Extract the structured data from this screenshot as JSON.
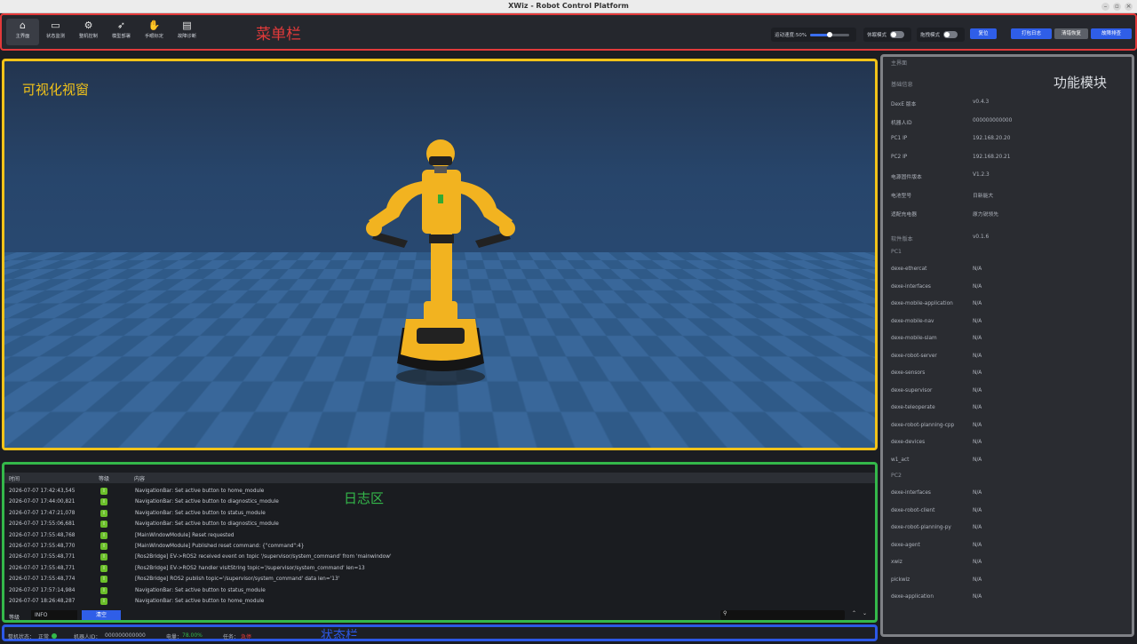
{
  "window": {
    "title": "XWiz - Robot Control Platform"
  },
  "menubar": {
    "annotation": "菜单栏",
    "nav": [
      {
        "label": "主界面",
        "icon": "home-icon",
        "glyph": "⌂"
      },
      {
        "label": "状态监测",
        "icon": "monitor-icon",
        "glyph": "▭"
      },
      {
        "label": "整机控制",
        "icon": "joystick-icon",
        "glyph": "⚙"
      },
      {
        "label": "模型部署",
        "icon": "rocket-icon",
        "glyph": "➶"
      },
      {
        "label": "手眼标定",
        "icon": "hand-icon",
        "glyph": "✋"
      },
      {
        "label": "故障诊断",
        "icon": "diagnostic-icon",
        "glyph": "▤"
      }
    ],
    "speed_label": "运动速度:50%",
    "speed_value": 0.5,
    "sleep_mode_label": "休眠模式",
    "drag_mode_label": "拖拽模式",
    "reset_label": "复位",
    "pack_log_label": "打包日志",
    "clear_error_label": "清错恢复",
    "fault_check_label": "故障排查"
  },
  "viewport": {
    "annotation": "可视化视窗"
  },
  "right_panel": {
    "header": "主界面",
    "annotation": "功能模块",
    "basic_info_title": "基础信息",
    "basic_info": [
      {
        "k": "DexE 版本",
        "v": "v0.4.3"
      },
      {
        "k": "机器人ID",
        "v": "000000000000"
      },
      {
        "k": "PC1 IP",
        "v": "192.168.20.20"
      },
      {
        "k": "PC2 IP",
        "v": "192.168.20.21"
      },
      {
        "k": "电源固件版本",
        "v": "V1.2.3"
      },
      {
        "k": "电池型号",
        "v": "日新能大"
      },
      {
        "k": "适配充电器",
        "v": "原力锐领先"
      }
    ],
    "software_title": "软件版本",
    "software_version": "v0.1.6",
    "pc1_title": "PC1",
    "pc1": [
      {
        "k": "dexe-ethercat",
        "v": "N/A"
      },
      {
        "k": "dexe-interfaces",
        "v": "N/A"
      },
      {
        "k": "dexe-mobile-application",
        "v": "N/A"
      },
      {
        "k": "dexe-mobile-nav",
        "v": "N/A"
      },
      {
        "k": "dexe-mobile-slam",
        "v": "N/A"
      },
      {
        "k": "dexe-robot-server",
        "v": "N/A"
      },
      {
        "k": "dexe-sensors",
        "v": "N/A"
      },
      {
        "k": "dexe-supervisor",
        "v": "N/A"
      },
      {
        "k": "dexe-teleoperate",
        "v": "N/A"
      },
      {
        "k": "dexe-robot-planning-cpp",
        "v": "N/A"
      },
      {
        "k": "dexe-devices",
        "v": "N/A"
      },
      {
        "k": "w1_act",
        "v": "N/A"
      }
    ],
    "pc2_title": "PC2",
    "pc2": [
      {
        "k": "dexe-interfaces",
        "v": "N/A"
      },
      {
        "k": "dexe-robot-client",
        "v": "N/A"
      },
      {
        "k": "dexe-robot-planning-py",
        "v": "N/A"
      },
      {
        "k": "dexe-agent",
        "v": "N/A"
      },
      {
        "k": "xwiz",
        "v": "N/A"
      },
      {
        "k": "pickwiz",
        "v": "N/A"
      },
      {
        "k": "dexe-application",
        "v": "N/A"
      }
    ]
  },
  "log": {
    "annotation": "日志区",
    "col_time": "时间",
    "col_level": "等级",
    "col_content": "内容",
    "rows": [
      {
        "t": "2026-07-07 17:42:43,545",
        "lv": "I",
        "m": "NavigationBar: Set active button to home_module"
      },
      {
        "t": "2026-07-07 17:44:00,821",
        "lv": "I",
        "m": "NavigationBar: Set active button to diagnostics_module"
      },
      {
        "t": "2026-07-07 17:47:21,078",
        "lv": "I",
        "m": "NavigationBar: Set active button to status_module"
      },
      {
        "t": "2026-07-07 17:55:06,681",
        "lv": "I",
        "m": "NavigationBar: Set active button to diagnostics_module"
      },
      {
        "t": "2026-07-07 17:55:48,768",
        "lv": "I",
        "m": "[MainWindowModule] Reset requested"
      },
      {
        "t": "2026-07-07 17:55:48,770",
        "lv": "I",
        "m": "[MainWindowModule] Published reset command: {\"command\":4}"
      },
      {
        "t": "2026-07-07 17:55:48,771",
        "lv": "I",
        "m": "[Ros2Bridge] EV->ROS2 received event on topic '/supervisor/system_command' from 'mainwindow'"
      },
      {
        "t": "2026-07-07 17:55:48,771",
        "lv": "I",
        "m": "[Ros2Bridge] EV->ROS2 handler visitString topic='/supervisor/system_command' len=13"
      },
      {
        "t": "2026-07-07 17:55:48,774",
        "lv": "I",
        "m": "[Ros2Bridge] ROS2 publish topic='/supervisor/system_command' data len='13'"
      },
      {
        "t": "2026-07-07 17:57:14,984",
        "lv": "I",
        "m": "NavigationBar: Set active button to status_module"
      },
      {
        "t": "2026-07-07 18:26:48,287",
        "lv": "I",
        "m": "NavigationBar: Set active button to home_module"
      }
    ],
    "level_label": "等级",
    "level_value": "INFO",
    "clear_label": "清空"
  },
  "status": {
    "annotation": "状态栏",
    "machine_label": "整机状态：",
    "machine_value": "正常",
    "robot_id_label": "机器人ID：",
    "robot_id_value": "000000000000",
    "power_label": "电量：",
    "power_value": "78.00%",
    "task_label": "任务：",
    "task_value": "急停"
  },
  "colors": {
    "accent": "#2f5ee8",
    "ok": "#34b84a",
    "warn": "#f2c319",
    "err": "#e23a3a"
  }
}
